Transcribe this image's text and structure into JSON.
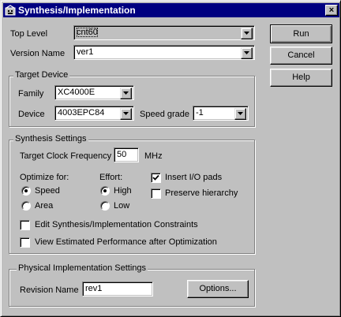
{
  "window": {
    "title": "Synthesis/Implementation",
    "close": "×"
  },
  "top_level": {
    "label": "Top Level",
    "value": "cnt60"
  },
  "version_name": {
    "label": "Version Name",
    "value": "ver1"
  },
  "buttons": {
    "run": "Run",
    "cancel": "Cancel",
    "help": "Help"
  },
  "target_device": {
    "title": "Target Device",
    "family_label": "Family",
    "family_value": "XC4000E",
    "device_label": "Device",
    "device_value": "4003EPC84",
    "speed_label": "Speed grade",
    "speed_value": "-1"
  },
  "synthesis": {
    "title": "Synthesis Settings",
    "clock_label": "Target Clock Frequency",
    "clock_value": "50",
    "clock_unit": "MHz",
    "optimize_label": "Optimize for:",
    "optimize_options": [
      {
        "label": "Speed",
        "selected": true
      },
      {
        "label": "Area",
        "selected": false
      }
    ],
    "effort_label": "Effort:",
    "effort_options": [
      {
        "label": "High",
        "selected": true
      },
      {
        "label": "Low",
        "selected": false
      }
    ],
    "insert_io": {
      "label": "Insert I/O pads",
      "checked": true
    },
    "preserve": {
      "label": "Preserve hierarchy",
      "checked": false
    },
    "edit_constraints": {
      "label": "Edit Synthesis/Implementation Constraints",
      "checked": false
    },
    "view_perf": {
      "label": "View Estimated Performance after Optimization",
      "checked": false
    }
  },
  "physical": {
    "title": "Physical Implementation Settings",
    "revision_label": "Revision Name",
    "revision_value": "rev1",
    "options_button": "Options..."
  }
}
